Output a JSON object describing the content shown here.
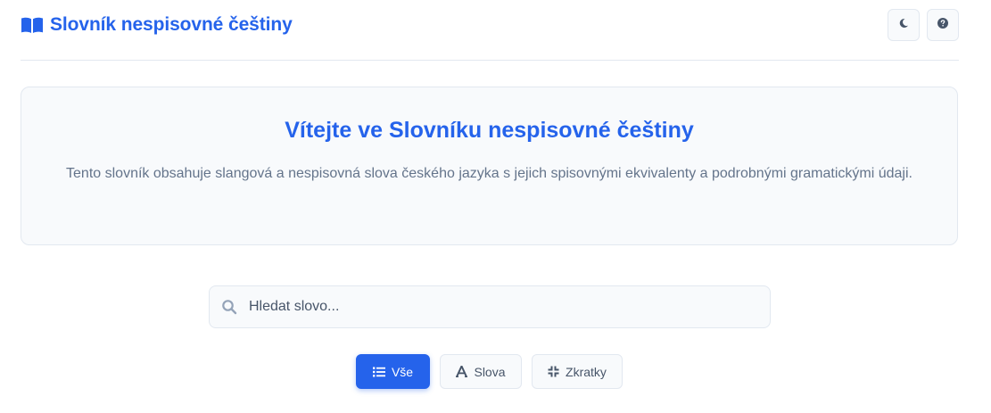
{
  "header": {
    "title": "Slovník nespisovné češtiny",
    "brand_icon": "book-open-icon",
    "theme_icon": "moon-icon",
    "help_icon": "question-circle-icon"
  },
  "welcome": {
    "title": "Vítejte ve Slovníku nespisovné češtiny",
    "text": "Tento slovník obsahuje slangová a nespisovná slova českého jazyka s jejich spisovnými ekvivalenty a podrobnými gramatickými údaji."
  },
  "search": {
    "placeholder": "Hledat slovo...",
    "value": "",
    "icon": "search-icon"
  },
  "filters": [
    {
      "label": "Vše",
      "icon": "list-icon",
      "active": true
    },
    {
      "label": "Slova",
      "icon": "font-icon",
      "active": false
    },
    {
      "label": "Zkratky",
      "icon": "compress-icon",
      "active": false
    }
  ],
  "colors": {
    "accent": "#2563eb",
    "border": "#e2e8f0",
    "surface": "#f8fafc",
    "muted_text": "#64748b"
  }
}
